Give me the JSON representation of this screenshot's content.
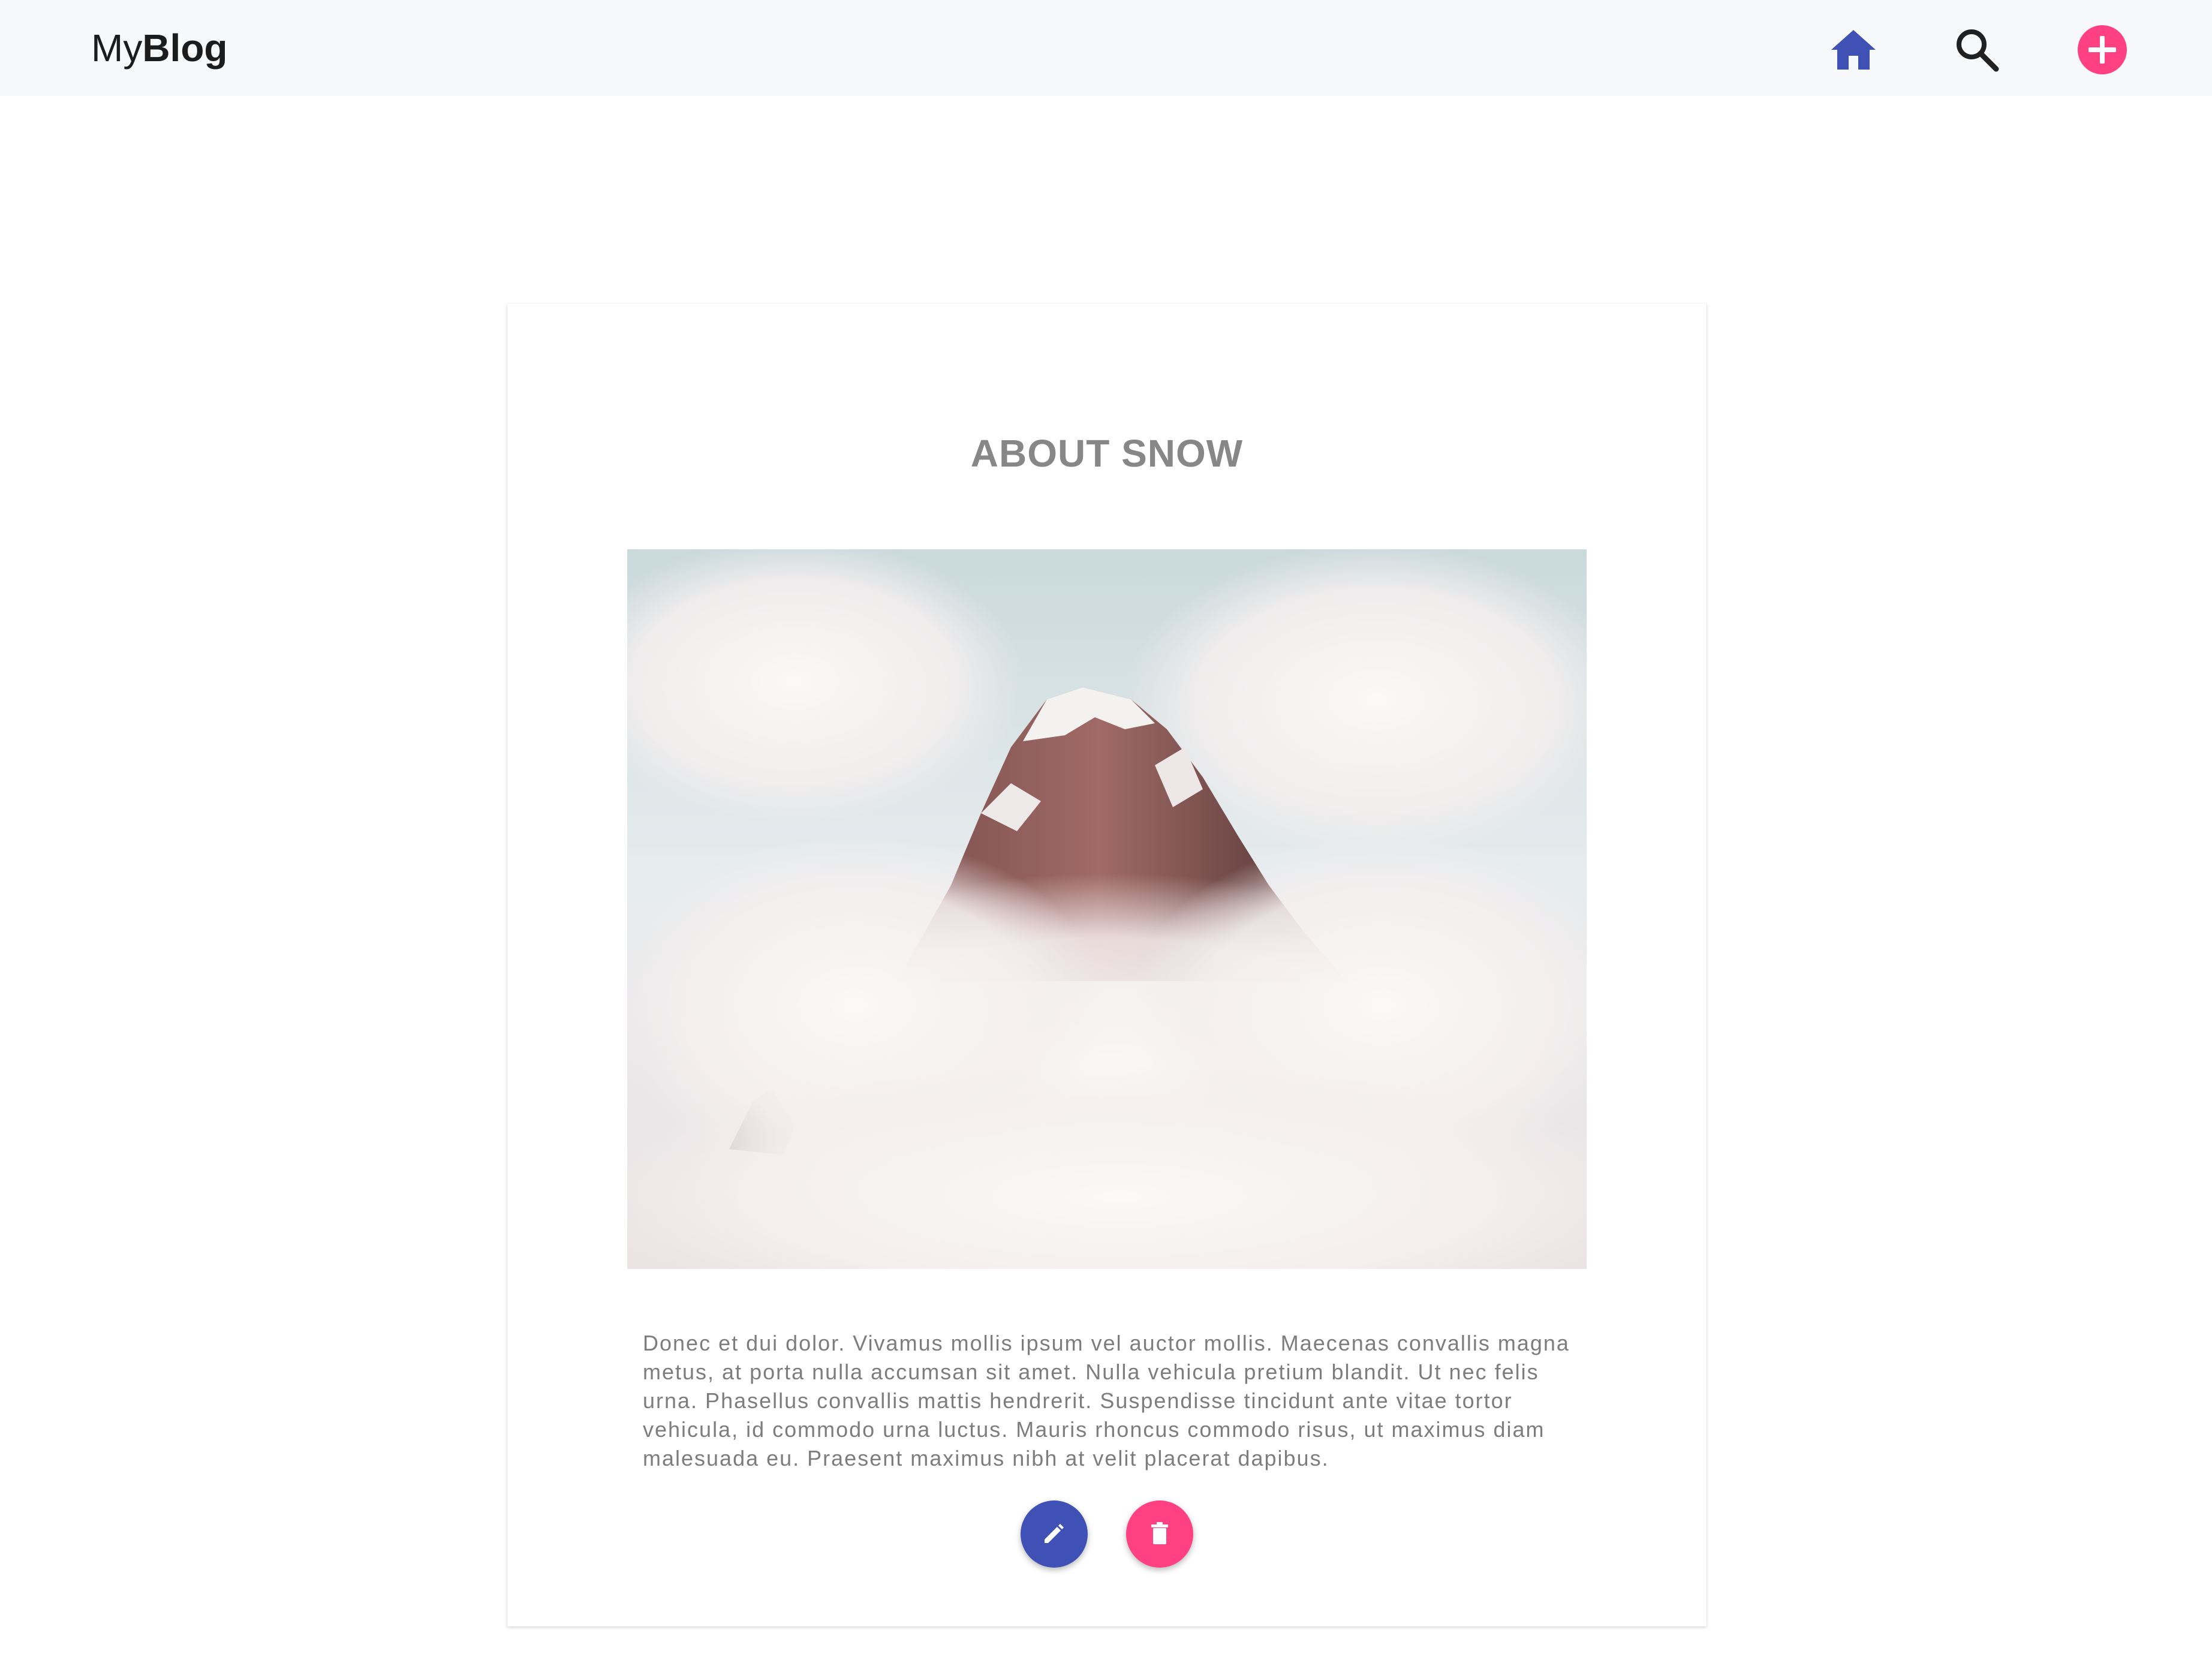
{
  "app": {
    "brand_light": "My",
    "brand_bold": "Blog"
  },
  "nav": {
    "icons": [
      "home-icon",
      "search-icon",
      "add-circle-icon"
    ]
  },
  "post": {
    "title": "ABOUT SNOW",
    "image_subject": "snowy mountain peak in clouds",
    "body": "Donec et dui dolor. Vivamus mollis ipsum vel auctor mollis. Maecenas convallis magna metus, at porta nulla accumsan sit amet. Nulla vehicula pretium blandit. Ut nec felis urna. Phasellus convallis mattis hendrerit. Suspendisse tincidunt ante vitae tortor vehicula, id commodo urna luctus. Mauris rhoncus commodo risus, ut maximus diam malesuada eu. Praesent maximus nibh at velit placerat dapibus."
  },
  "actions": {
    "edit_icon": "pencil-icon",
    "delete_icon": "trash-icon"
  },
  "colors": {
    "primary": "#3f51b5",
    "accent": "#ff4081",
    "navbar_bg": "#f7f8fa",
    "title_text": "#878787",
    "body_text": "#7d7d7d"
  }
}
